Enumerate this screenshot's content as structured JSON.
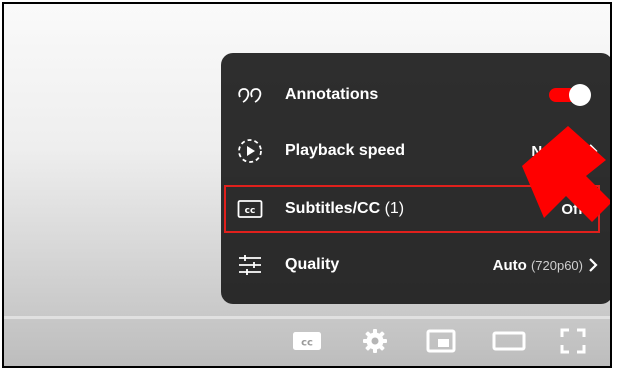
{
  "settings_menu": {
    "items": [
      {
        "label": "Annotations",
        "icon": "annotations-icon",
        "toggle_on": true
      },
      {
        "label": "Playback speed",
        "value": "Normal",
        "icon": "playback-speed-icon"
      },
      {
        "label": "Subtitles/CC",
        "label_suffix": "(1)",
        "value": "Off",
        "icon": "subtitles-cc-icon"
      },
      {
        "label": "Quality",
        "value": "Auto",
        "value_detail": "(720p60)",
        "icon": "quality-sliders-icon"
      }
    ]
  },
  "controls": {
    "buttons": [
      "subtitles-icon",
      "settings-gear-icon",
      "miniplayer-icon",
      "theater-mode-icon",
      "fullscreen-icon"
    ]
  },
  "colors": {
    "menu_bg": "#1c1c1c",
    "toggle_on": "#ff0000",
    "highlight": "#e0201c",
    "arrow": "#ff0000"
  }
}
